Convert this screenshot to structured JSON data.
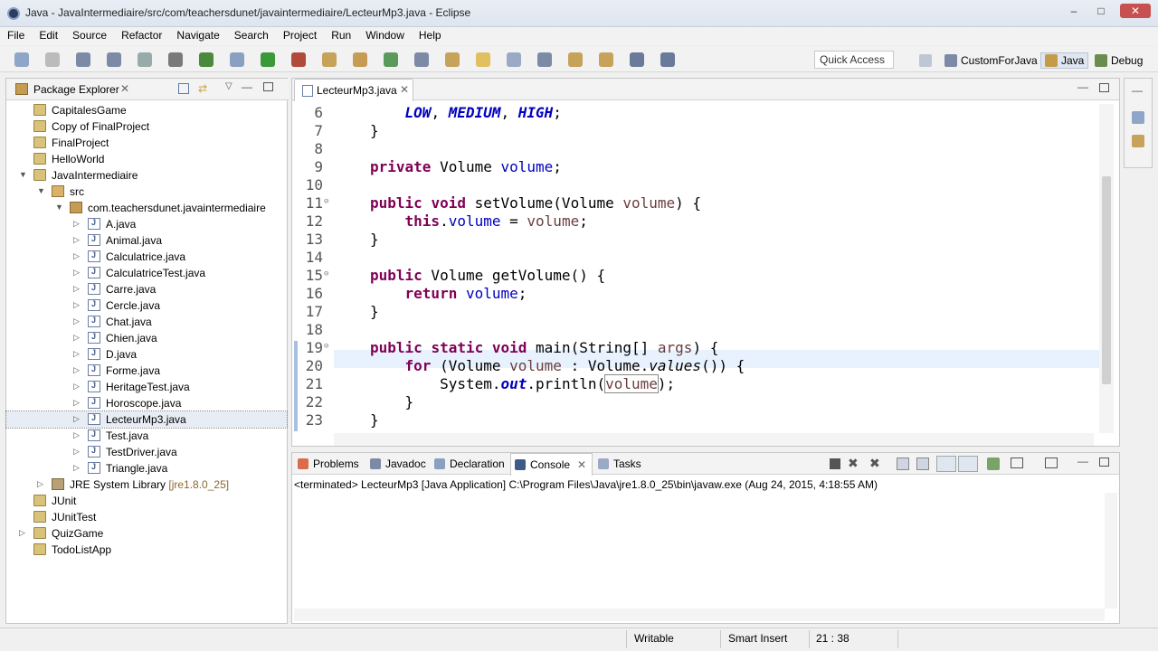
{
  "window": {
    "title": "Java - JavaIntermediaire/src/com/teachersdunet/javaintermediaire/LecteurMp3.java - Eclipse"
  },
  "menu": [
    "File",
    "Edit",
    "Source",
    "Refactor",
    "Navigate",
    "Search",
    "Project",
    "Run",
    "Window",
    "Help"
  ],
  "toolbar": {
    "quick_access": "Quick Access",
    "perspectives": [
      "CustomForJava",
      "Java",
      "Debug"
    ]
  },
  "package_explorer": {
    "title": "Package Explorer",
    "items": [
      {
        "label": "CapitalesGame",
        "indent": 0,
        "arrow": "",
        "icon": "proj"
      },
      {
        "label": "Copy of FinalProject",
        "indent": 0,
        "arrow": "",
        "icon": "proj"
      },
      {
        "label": "FinalProject",
        "indent": 0,
        "arrow": "",
        "icon": "proj"
      },
      {
        "label": "HelloWorld",
        "indent": 0,
        "arrow": "",
        "icon": "proj"
      },
      {
        "label": "JavaIntermediaire",
        "indent": 0,
        "arrow": "▼",
        "icon": "proj"
      },
      {
        "label": "src",
        "indent": 1,
        "arrow": "▼",
        "icon": "srci"
      },
      {
        "label": "com.teachersdunet.javaintermediaire",
        "indent": 2,
        "arrow": "▼",
        "icon": "pkgi"
      },
      {
        "label": "A.java",
        "indent": 3,
        "arrow": "▷",
        "icon": "file"
      },
      {
        "label": "Animal.java",
        "indent": 3,
        "arrow": "▷",
        "icon": "file"
      },
      {
        "label": "Calculatrice.java",
        "indent": 3,
        "arrow": "▷",
        "icon": "file"
      },
      {
        "label": "CalculatriceTest.java",
        "indent": 3,
        "arrow": "▷",
        "icon": "file"
      },
      {
        "label": "Carre.java",
        "indent": 3,
        "arrow": "▷",
        "icon": "file"
      },
      {
        "label": "Cercle.java",
        "indent": 3,
        "arrow": "▷",
        "icon": "file"
      },
      {
        "label": "Chat.java",
        "indent": 3,
        "arrow": "▷",
        "icon": "file"
      },
      {
        "label": "Chien.java",
        "indent": 3,
        "arrow": "▷",
        "icon": "file"
      },
      {
        "label": "D.java",
        "indent": 3,
        "arrow": "▷",
        "icon": "file"
      },
      {
        "label": "Forme.java",
        "indent": 3,
        "arrow": "▷",
        "icon": "file"
      },
      {
        "label": "HeritageTest.java",
        "indent": 3,
        "arrow": "▷",
        "icon": "file"
      },
      {
        "label": "Horoscope.java",
        "indent": 3,
        "arrow": "▷",
        "icon": "file"
      },
      {
        "label": "LecteurMp3.java",
        "indent": 3,
        "arrow": "▷",
        "icon": "file"
      },
      {
        "label": "Test.java",
        "indent": 3,
        "arrow": "▷",
        "icon": "file"
      },
      {
        "label": "TestDriver.java",
        "indent": 3,
        "arrow": "▷",
        "icon": "file"
      },
      {
        "label": "Triangle.java",
        "indent": 3,
        "arrow": "▷",
        "icon": "file"
      },
      {
        "label": "JRE System Library",
        "suffix": " [jre1.8.0_25]",
        "indent": 1,
        "arrow": "▷",
        "icon": "jre"
      },
      {
        "label": "JUnit",
        "indent": 0,
        "arrow": "",
        "icon": "proj"
      },
      {
        "label": "JUnitTest",
        "indent": 0,
        "arrow": "",
        "icon": "proj"
      },
      {
        "label": "QuizGame",
        "indent": 0,
        "arrow": "▷",
        "icon": "proj"
      },
      {
        "label": "TodoListApp",
        "indent": 0,
        "arrow": "",
        "icon": "proj"
      }
    ]
  },
  "editor": {
    "tab": "LecteurMp3.java",
    "lines": [
      {
        "n": "6",
        "fold": "",
        "html": "    <span class=\"sfld\">LOW</span>, <span class=\"sfld\">MEDIUM</span>, <span class=\"sfld\">HIGH</span>;"
      },
      {
        "n": "7",
        "fold": "",
        "html": "}"
      },
      {
        "n": "8",
        "fold": "",
        "html": ""
      },
      {
        "n": "9",
        "fold": "",
        "html": "<span class=\"kw\">private</span> Volume <span class=\"fld\">volume</span>;"
      },
      {
        "n": "10",
        "fold": "",
        "html": ""
      },
      {
        "n": "11",
        "fold": "⊖",
        "html": "<span class=\"kw\">public</span> <span class=\"kw\">void</span> setVolume(Volume <span class=\"par\">volume</span>) {"
      },
      {
        "n": "12",
        "fold": "",
        "html": "    <span class=\"kw\">this</span>.<span class=\"fld\">volume</span> = <span class=\"par\">volume</span>;"
      },
      {
        "n": "13",
        "fold": "",
        "html": "}"
      },
      {
        "n": "14",
        "fold": "",
        "html": ""
      },
      {
        "n": "15",
        "fold": "⊖",
        "html": "<span class=\"kw\">public</span> Volume getVolume() {"
      },
      {
        "n": "16",
        "fold": "",
        "html": "    <span class=\"kw\">return</span> <span class=\"fld\">volume</span>;"
      },
      {
        "n": "17",
        "fold": "",
        "html": "}"
      },
      {
        "n": "18",
        "fold": "",
        "html": ""
      },
      {
        "n": "19",
        "fold": "⊖",
        "html": "<span class=\"kw\">public</span> <span class=\"kw\">static</span> <span class=\"kw\">void</span> main(String[] <span class=\"par\">args</span>) {"
      },
      {
        "n": "20",
        "fold": "",
        "html": "    <span class=\"kw\">for</span> (Volume <span class=\"par\">volume</span> : Volume.<span class=\"ital\">values</span>()) {"
      },
      {
        "n": "21",
        "fold": "",
        "html": "        System.<span class=\"sfld\">out</span>.println(<span class=\"par\" style=\"outline:1px solid #888\">volume</span>);"
      },
      {
        "n": "22",
        "fold": "",
        "html": "    }"
      },
      {
        "n": "23",
        "fold": "",
        "html": "}"
      }
    ]
  },
  "bottom": {
    "tabs": [
      "Problems",
      "Javadoc",
      "Declaration",
      "Console",
      "Tasks"
    ],
    "console_text": "<terminated> LecteurMp3 [Java Application] C:\\Program Files\\Java\\jre1.8.0_25\\bin\\javaw.exe (Aug 24, 2015, 4:18:55 AM)"
  },
  "status": {
    "writable": "Writable",
    "insert": "Smart Insert",
    "position": "21 : 38"
  }
}
